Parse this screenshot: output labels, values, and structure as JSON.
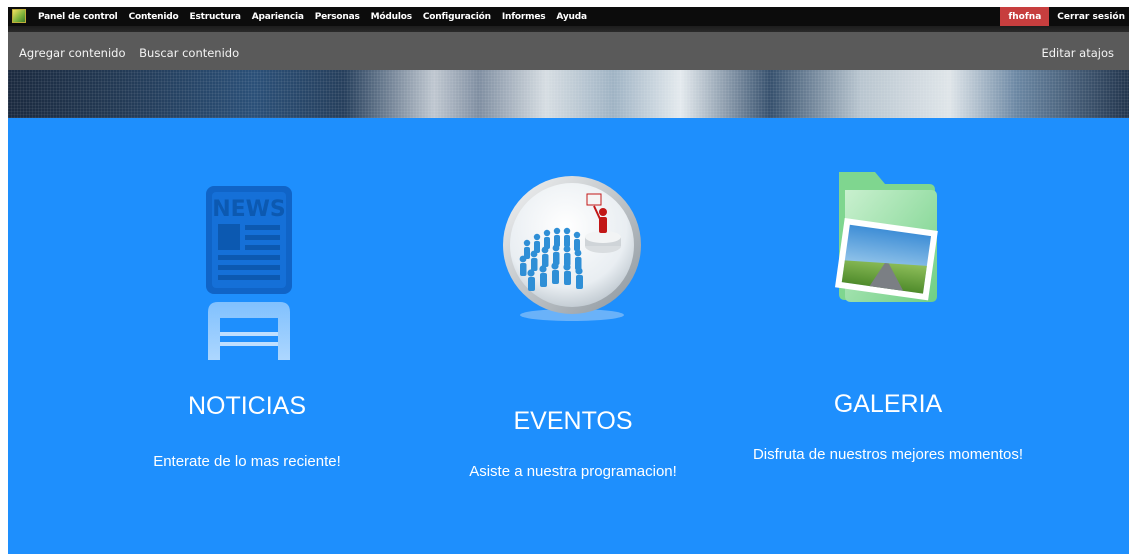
{
  "toolbar": {
    "menu": [
      "Panel de control",
      "Contenido",
      "Estructura",
      "Apariencia",
      "Personas",
      "Módulos",
      "Configuración",
      "Informes",
      "Ayuda"
    ],
    "user": "fhofna",
    "logout": "Cerrar sesión"
  },
  "shortcuts": {
    "items": [
      "Agregar contenido",
      "Buscar contenido"
    ],
    "edit": "Editar atajos"
  },
  "cards": [
    {
      "title": "NOTICIAS",
      "subtitle": "Enterate de lo mas reciente!",
      "icon_text": "NEWS"
    },
    {
      "title": "EVENTOS",
      "subtitle": "Asiste a nuestra programacion!"
    },
    {
      "title": "GALERIA",
      "subtitle": "Disfruta de nuestros mejores momentos!"
    }
  ],
  "colors": {
    "panel": "#1e8ffd",
    "toolbar": "#0c0c0c",
    "shortcuts": "#5a5a5a",
    "user_badge": "#c73e3e"
  }
}
